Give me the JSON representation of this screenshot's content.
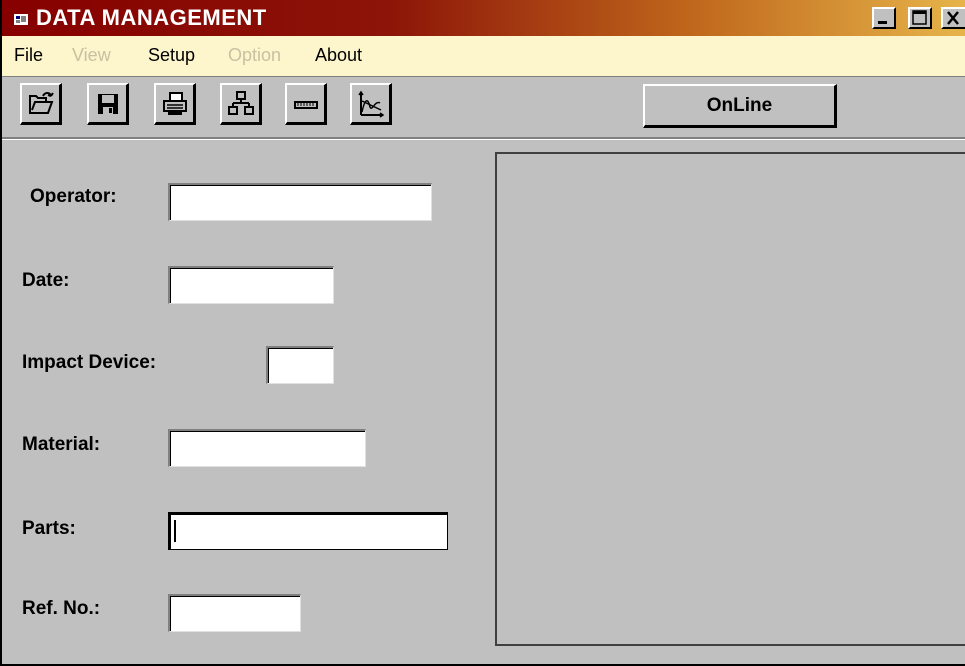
{
  "window": {
    "title": "DATA MANAGEMENT",
    "controls": [
      "minimize",
      "maximize",
      "close"
    ]
  },
  "menu": {
    "items": [
      {
        "label": "File",
        "enabled": true
      },
      {
        "label": "View",
        "enabled": false
      },
      {
        "label": "Setup",
        "enabled": true
      },
      {
        "label": "Option",
        "enabled": false
      },
      {
        "label": "About",
        "enabled": true
      }
    ]
  },
  "toolbar": {
    "icons": [
      "open-folder-icon",
      "save-disk-icon",
      "printer-icon",
      "network-tree-icon",
      "ruler-icon",
      "graph-icon"
    ],
    "online_label": "OnLine"
  },
  "form": {
    "operator_label": "Operator:",
    "operator_value": "",
    "date_label": "Date:",
    "date_value": "",
    "impact_device_label": "Impact Device:",
    "impact_device_value": "",
    "material_label": "Material:",
    "material_value": "",
    "parts_label": "Parts:",
    "parts_value": "",
    "ref_no_label": "Ref. No.:",
    "ref_no_value": ""
  },
  "colors": {
    "titlebar_start": "#860000",
    "titlebar_end": "#e6b44a",
    "menubar_bg": "#fdf5cc",
    "window_bg": "#c0c0c0"
  }
}
